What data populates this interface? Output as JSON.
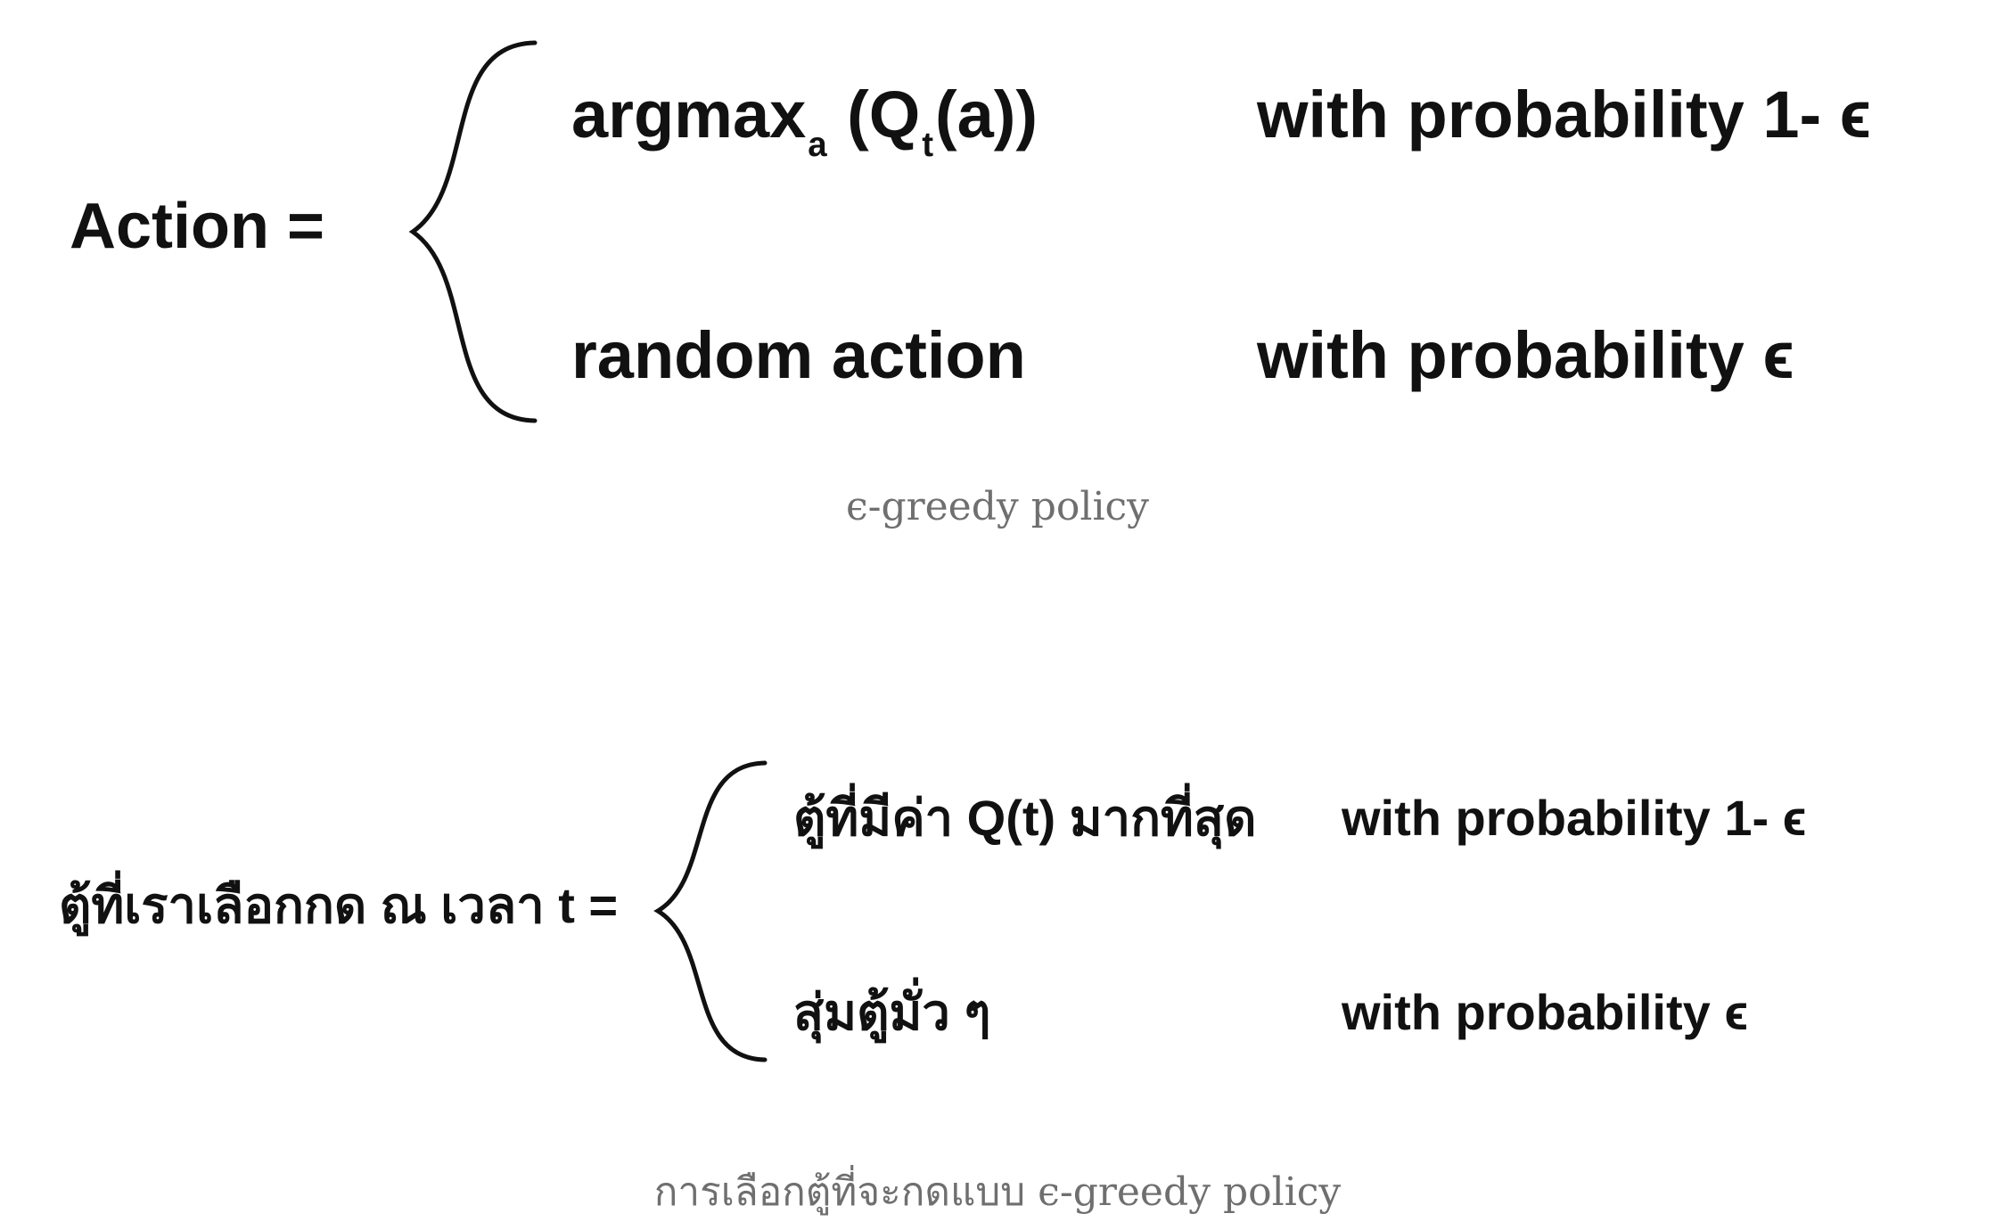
{
  "figures": [
    {
      "lhs": "Action  =",
      "cases": [
        {
          "expression_main": "argmax",
          "expression_sub_a": "a",
          "expression_mid": " (Q",
          "expression_sub_t": "t",
          "expression_end": "(a))",
          "condition": "with probability 1- ϵ"
        },
        {
          "expression": "random action",
          "condition": "with probability ϵ"
        }
      ],
      "caption": "ϵ-greedy policy"
    },
    {
      "lhs": "ตู้ที่เราเลือกกด ณ เวลา t =",
      "cases": [
        {
          "expression": "ตู้ที่มีค่า Q(t) มากที่สุด",
          "condition": "with probability 1- ϵ"
        },
        {
          "expression": "สุ่มตู้มั่ว ๆ",
          "condition": "with probability ϵ"
        }
      ],
      "caption": "การเลือกตู้ที่จะกดแบบ ϵ-greedy policy"
    }
  ],
  "colors": {
    "text": "#111111",
    "caption": "#6f6f6f",
    "background": "#ffffff"
  }
}
